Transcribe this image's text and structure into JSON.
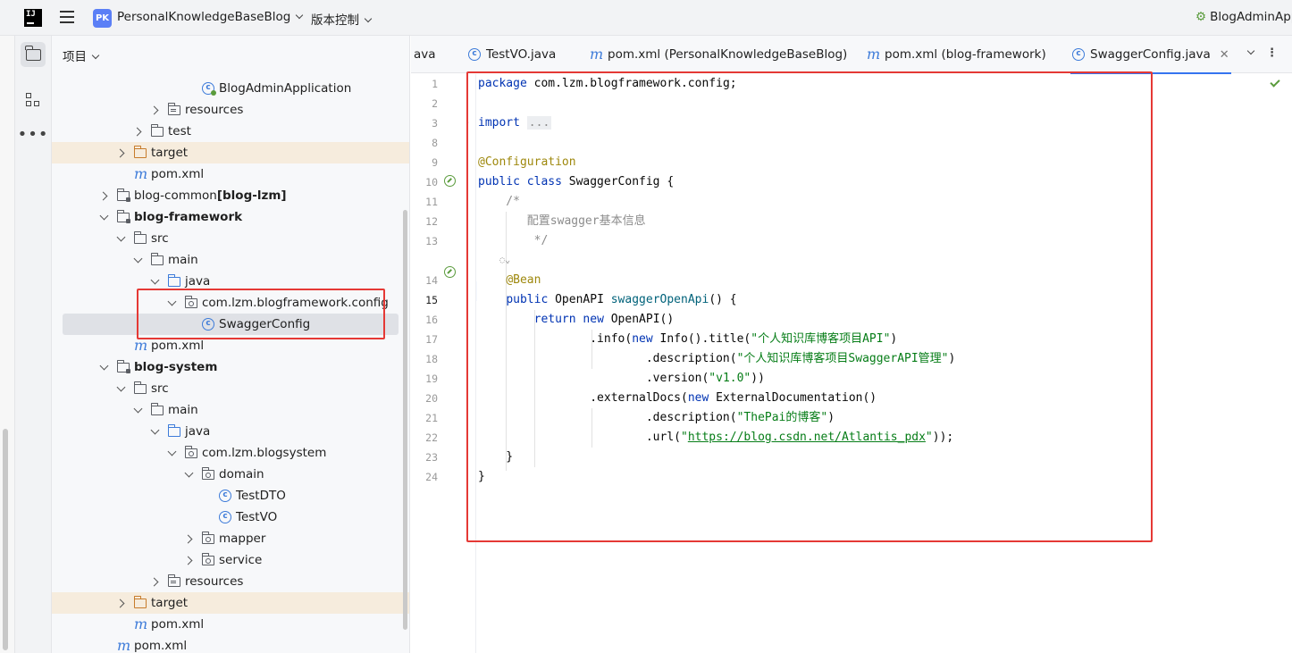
{
  "topbar": {
    "logo_text": "IJ",
    "project_badge": "PK",
    "project_name": "PersonalKnowledgeBaseBlog",
    "vcs_label": "版本控制",
    "run_config": "BlogAdminApp"
  },
  "project_panel": {
    "title": "项目"
  },
  "tree": [
    {
      "label": "BlogAdminApplication",
      "indent": 7,
      "arrow": "none",
      "icon": "cls-boot"
    },
    {
      "label": "resources",
      "indent": 5,
      "arrow": "right",
      "icon": "folder-res"
    },
    {
      "label": "test",
      "indent": 4,
      "arrow": "right",
      "icon": "folder"
    },
    {
      "label": "target",
      "indent": 3,
      "arrow": "right",
      "icon": "folder-excl",
      "excluded": true
    },
    {
      "label": "pom.xml",
      "indent": 3,
      "arrow": "none",
      "icon": "mvn"
    },
    {
      "label": "blog-common",
      "suffix": "[blog-lzm]",
      "indent": 2,
      "arrow": "right",
      "icon": "folder-mod"
    },
    {
      "label": "blog-framework",
      "indent": 2,
      "arrow": "down",
      "icon": "folder-mod",
      "bold": true
    },
    {
      "label": "src",
      "indent": 3,
      "arrow": "down",
      "icon": "folder"
    },
    {
      "label": "main",
      "indent": 4,
      "arrow": "down",
      "icon": "folder"
    },
    {
      "label": "java",
      "indent": 5,
      "arrow": "down",
      "icon": "folder-src"
    },
    {
      "label": "com.lzm.blogframework.config",
      "indent": 6,
      "arrow": "down",
      "icon": "folder-pkg"
    },
    {
      "label": "SwaggerConfig",
      "indent": 7,
      "arrow": "none",
      "icon": "cls",
      "selected": true
    },
    {
      "label": "pom.xml",
      "indent": 3,
      "arrow": "none",
      "icon": "mvn"
    },
    {
      "label": "blog-system",
      "indent": 2,
      "arrow": "down",
      "icon": "folder-mod",
      "bold": true
    },
    {
      "label": "src",
      "indent": 3,
      "arrow": "down",
      "icon": "folder"
    },
    {
      "label": "main",
      "indent": 4,
      "arrow": "down",
      "icon": "folder"
    },
    {
      "label": "java",
      "indent": 5,
      "arrow": "down",
      "icon": "folder-src"
    },
    {
      "label": "com.lzm.blogsystem",
      "indent": 6,
      "arrow": "down",
      "icon": "folder-pkg"
    },
    {
      "label": "domain",
      "indent": 7,
      "arrow": "down",
      "icon": "folder-pkg"
    },
    {
      "label": "TestDTO",
      "indent": 8,
      "arrow": "none",
      "icon": "cls"
    },
    {
      "label": "TestVO",
      "indent": 8,
      "arrow": "none",
      "icon": "cls"
    },
    {
      "label": "mapper",
      "indent": 7,
      "arrow": "right",
      "icon": "folder-pkg"
    },
    {
      "label": "service",
      "indent": 7,
      "arrow": "right",
      "icon": "folder-pkg"
    },
    {
      "label": "resources",
      "indent": 5,
      "arrow": "right",
      "icon": "folder-res"
    },
    {
      "label": "target",
      "indent": 3,
      "arrow": "right",
      "icon": "folder-excl",
      "excluded": true
    },
    {
      "label": "pom.xml",
      "indent": 3,
      "arrow": "none",
      "icon": "mvn"
    },
    {
      "label": "pom.xml",
      "indent": 2,
      "arrow": "none",
      "icon": "mvn"
    }
  ],
  "tabs": [
    {
      "label": "ava",
      "icon": "none"
    },
    {
      "label": "TestVO.java",
      "icon": "cls"
    },
    {
      "label": "pom.xml (PersonalKnowledgeBaseBlog)",
      "icon": "mvn"
    },
    {
      "label": "pom.xml (blog-framework)",
      "icon": "mvn"
    },
    {
      "label": "SwaggerConfig.java",
      "icon": "cls",
      "active": true
    }
  ],
  "editor": {
    "current_line": "15",
    "line_numbers": [
      "1",
      "2",
      "3",
      "8",
      "9",
      "10",
      "11",
      "12",
      "13",
      "",
      "14",
      "15",
      "16",
      "17",
      "18",
      "19",
      "20",
      "21",
      "22",
      "23",
      "24"
    ],
    "code": {
      "l1_kw": "package",
      "l1_rest": " com.lzm.blogframework.config;",
      "l3_kw": "import",
      "l3_fold": "...",
      "l9_ann": "@Configuration",
      "l10_kw": "public class",
      "l10_rest": " SwaggerConfig {",
      "l11": "    /*",
      "l12": "       配置swagger基本信息",
      "l13": "        */",
      "hint": "    ◌⌄",
      "l14_ann": "@Bean",
      "l15_kw": "public",
      "l15_type": " OpenAPI ",
      "l15_fn": "swaggerOpenApi",
      "l15_rest": "() {",
      "l16_kw": "return new",
      "l16_rest": " OpenAPI()",
      "l17_a": ".info(",
      "l17_kw": "new",
      "l17_b": " Info().title(",
      "l17_str": "\"个人知识库博客项目API\"",
      "l17_c": ")",
      "l18_a": ".description(",
      "l18_str": "\"个人知识库博客项目SwaggerAPI管理\"",
      "l18_c": ")",
      "l19_a": ".version(",
      "l19_str": "\"v1.0\"",
      "l19_c": "))",
      "l20_a": ".externalDocs(",
      "l20_kw": "new",
      "l20_b": " ExternalDocumentation()",
      "l21_a": ".description(",
      "l21_str": "\"ThePai的博客\"",
      "l21_c": ")",
      "l22_a": ".url(",
      "l22_q1": "\"",
      "l22_link": "https://blog.csdn.net/Atlantis_pdx",
      "l22_q2": "\"",
      "l22_c": "));",
      "l23": "    }",
      "l24": "}"
    }
  }
}
